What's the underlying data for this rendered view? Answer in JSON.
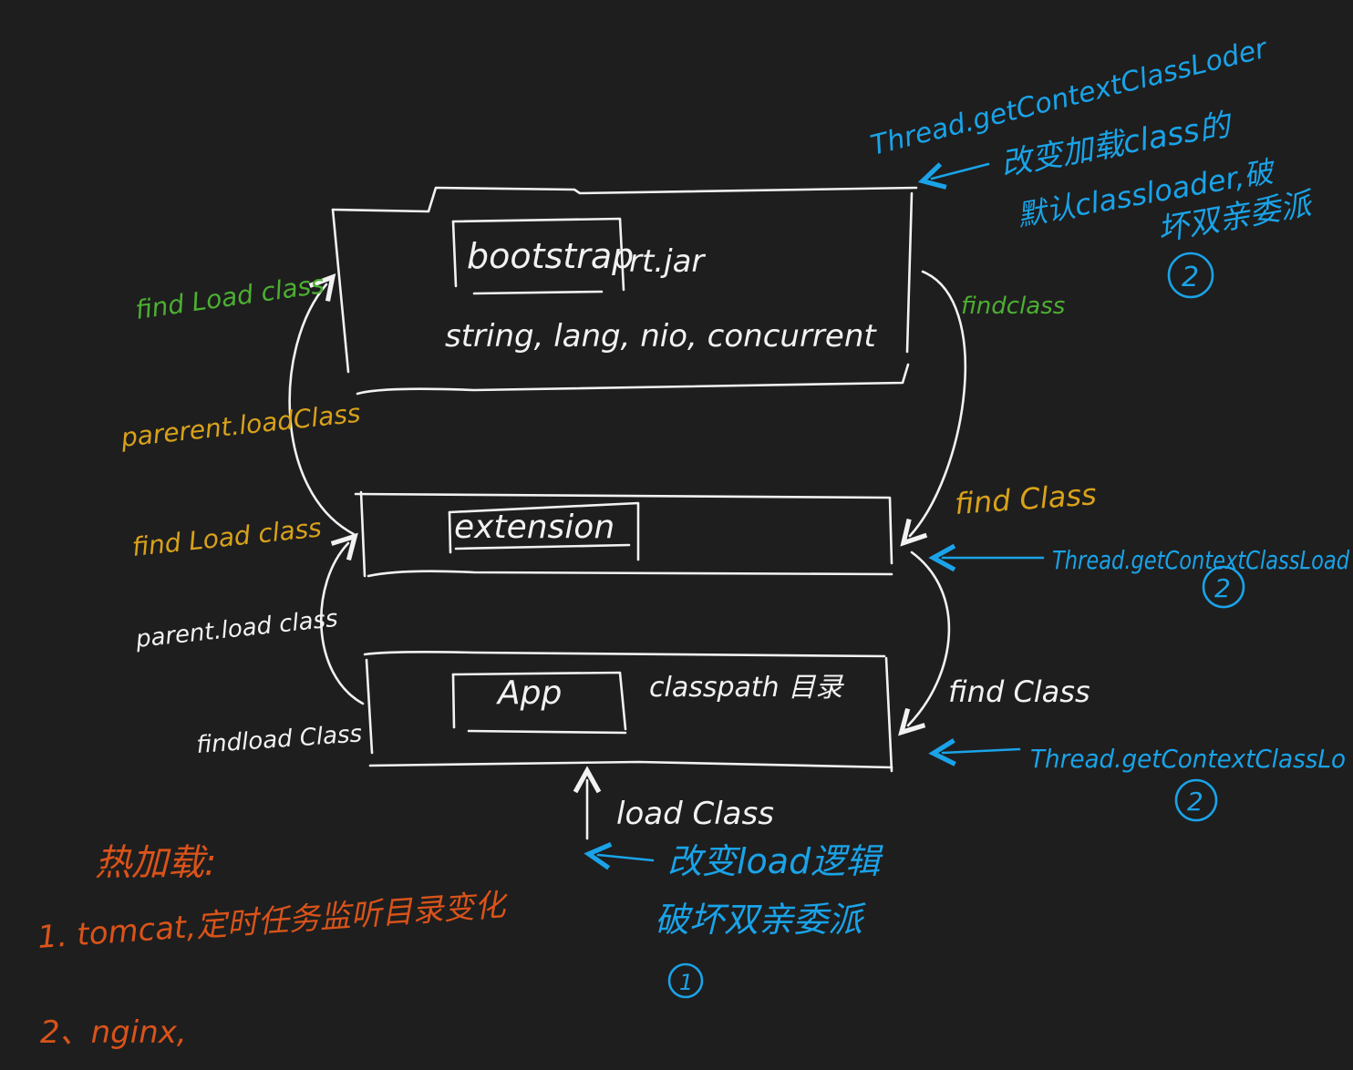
{
  "colors": {
    "background": "#1e1e1e",
    "white": "#f2f2f2",
    "green": "#4caf32",
    "yellow": "#d9a21a",
    "blue": "#1aa3e8",
    "orange": "#d9531a"
  },
  "loaders": {
    "bootstrap": {
      "name": "bootstrap",
      "jar": "rt.jar",
      "packages": "string, lang, nio, concurrent"
    },
    "extension": {
      "name": "extension"
    },
    "app": {
      "name": "App",
      "dir": "classpath 目录"
    }
  },
  "left_labels": {
    "find_load_class_top": "find Load class",
    "parent_load_class_top": "parerent.loadClass",
    "find_load_class_mid": "find Load class",
    "parent_load_class_mid": "parent.load class",
    "find_load_class_bottom": "findload Class"
  },
  "right_labels": {
    "find_class_top": "findclass",
    "find_class_mid": "find Class",
    "find_class_bottom": "find Class"
  },
  "thread_notes": {
    "top_line1": "Thread.getContextClassLoder",
    "top_line2": "改变加载class的",
    "top_line3": "默认classloader,破",
    "top_line4": "坏双亲委派",
    "top_marker": "2",
    "mid_line": "Thread.getContextClassLoad",
    "mid_marker": "2",
    "bottom_line": "Thread.getContextClassLo",
    "bottom_marker": "2"
  },
  "load_class": {
    "label": "load Class",
    "note_line1": "改变load逻辑",
    "note_line2": "破坏双亲委派",
    "marker": "1"
  },
  "hot_reload": {
    "title": "热加载:",
    "item1": "1. tomcat,定时任务监听目录变化",
    "item2": "2、nginx,"
  }
}
